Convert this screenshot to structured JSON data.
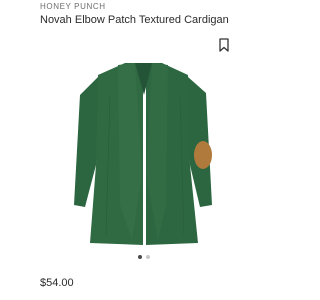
{
  "product": {
    "brand": "HONEY PUNCH",
    "name": "Novah Elbow Patch Textured Cardigan",
    "price": "$54.00",
    "image_icon": "cardigan-image",
    "colors": {
      "sweater": "#2f6a42",
      "elbow_patch": "#b07a3c"
    }
  },
  "bookmark": {
    "icon": "bookmark-icon"
  },
  "carousel": {
    "total": 2,
    "active_index": 1
  }
}
